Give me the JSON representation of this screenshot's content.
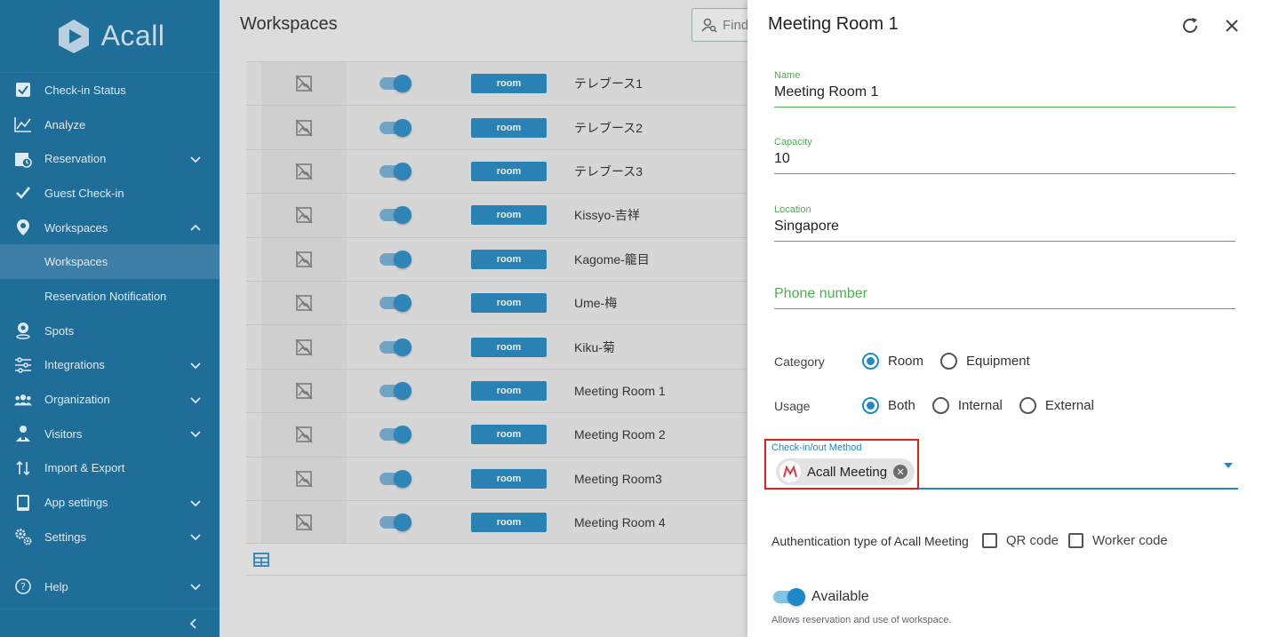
{
  "brand": {
    "name": "Acall"
  },
  "sidebar": {
    "items": [
      {
        "label": "Check-in Status",
        "icon": "checkbox-icon"
      },
      {
        "label": "Analyze",
        "icon": "chart-icon"
      },
      {
        "label": "Reservation",
        "icon": "calendar-icon",
        "expandable": true
      },
      {
        "label": "Guest Check-in",
        "icon": "check-icon"
      },
      {
        "label": "Workspaces",
        "icon": "pin-icon",
        "expanded": true
      },
      {
        "label": "Workspaces",
        "sub": true,
        "active": true
      },
      {
        "label": "Reservation Notification",
        "sub": true
      },
      {
        "label": "Spots",
        "icon": "spot-icon"
      },
      {
        "label": "Integrations",
        "icon": "sliders-icon",
        "expandable": true
      },
      {
        "label": "Organization",
        "icon": "people-icon",
        "expandable": true
      },
      {
        "label": "Visitors",
        "icon": "visitor-icon",
        "expandable": true
      },
      {
        "label": "Import & Export",
        "icon": "import-export-icon"
      },
      {
        "label": "App settings",
        "icon": "tablet-icon",
        "expandable": true
      },
      {
        "label": "Settings",
        "icon": "gears-icon",
        "expandable": true
      }
    ],
    "help": "Help"
  },
  "main": {
    "title": "Workspaces",
    "search_placeholder": "Find",
    "rows": [
      {
        "type": "room",
        "name": "テレブース1"
      },
      {
        "type": "room",
        "name": "テレブース2"
      },
      {
        "type": "room",
        "name": "テレブース3"
      },
      {
        "type": "room",
        "name": "Kissyo-吉祥"
      },
      {
        "type": "room",
        "name": "Kagome-籠目"
      },
      {
        "type": "room",
        "name": "Ume-梅"
      },
      {
        "type": "room",
        "name": "Kiku-菊"
      },
      {
        "type": "room",
        "name": "Meeting Room 1"
      },
      {
        "type": "room",
        "name": "Meeting Room 2"
      },
      {
        "type": "room",
        "name": "Meeting Room3"
      },
      {
        "type": "room",
        "name": "Meeting Room 4"
      }
    ]
  },
  "panel": {
    "title": "Meeting Room 1",
    "name_label": "Name",
    "name_value": "Meeting Room 1",
    "capacity_label": "Capacity",
    "capacity_value": "10",
    "location_label": "Location",
    "location_value": "Singapore",
    "phone_placeholder": "Phone number",
    "category_label": "Category",
    "category_options": [
      "Room",
      "Equipment"
    ],
    "category_selected": "Room",
    "usage_label": "Usage",
    "usage_options": [
      "Both",
      "Internal",
      "External"
    ],
    "usage_selected": "Both",
    "checkin_label": "Check-in/out Method",
    "checkin_value": "Acall Meeting",
    "auth_label": "Authentication type of Acall Meeting",
    "auth_options": [
      "QR code",
      "Worker code"
    ],
    "available_label": "Available",
    "available_note": "Allows reservation and use of workspace."
  },
  "colors": {
    "sidebar": "#1f6d99",
    "accent": "#1e88c9",
    "field_green": "#4caf50",
    "highlight": "#e02020"
  }
}
